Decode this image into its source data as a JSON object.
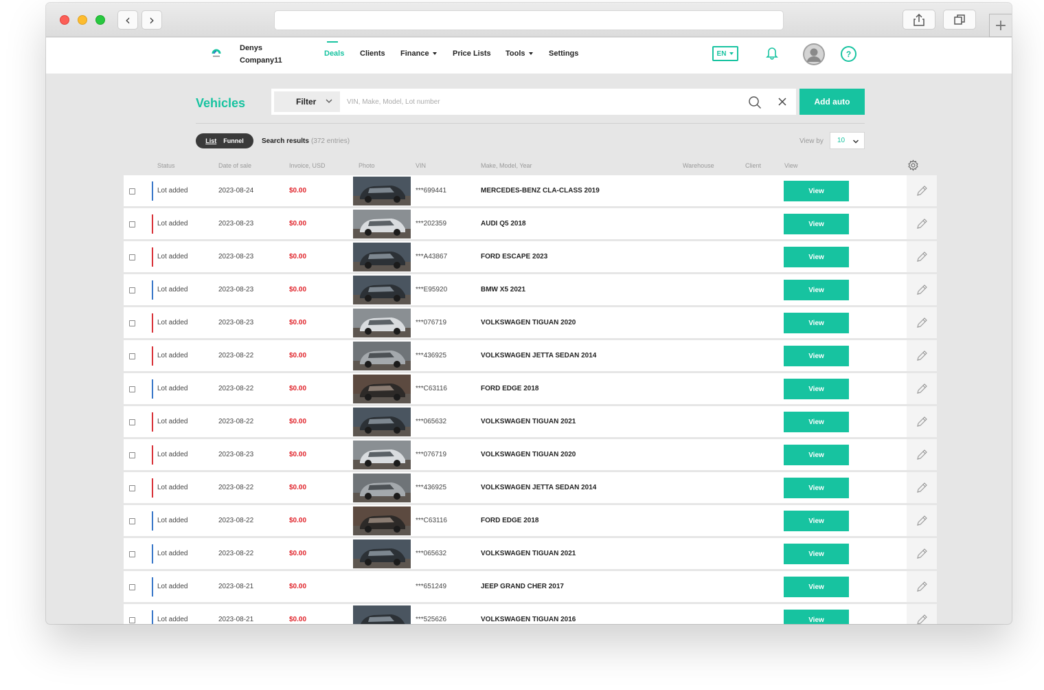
{
  "browser": {
    "back_icon": "‹",
    "forward_icon": "›",
    "new_tab_icon": "+"
  },
  "header": {
    "company_line1": "Denys",
    "company_line2": "Company11",
    "nav": [
      {
        "label": "Deals",
        "active": true
      },
      {
        "label": "Clients"
      },
      {
        "label": "Finance",
        "dropdown": true
      },
      {
        "label": "Price Lists"
      },
      {
        "label": "Tools",
        "dropdown": true
      },
      {
        "label": "Settings"
      }
    ],
    "language": "EN",
    "help": "?"
  },
  "toolbar": {
    "title": "Vehicles",
    "filter_label": "Filter",
    "search_placeholder": "VIN, Make, Model, Lot number",
    "add_label": "Add auto",
    "toggle_list": "List",
    "toggle_funnel": "Funnel",
    "results_label": "Search results",
    "results_count": "(372 entries)",
    "view_by_label": "View by",
    "view_by_value": "10"
  },
  "table": {
    "columns": [
      "Status",
      "Date of sale",
      "Invoice, USD",
      "Photo",
      "VIN",
      "Make, Model, Year",
      "Warehouse",
      "Client",
      "View"
    ],
    "view_label": "View",
    "colors": {
      "blue": "#3a78c9",
      "red": "#d9333a",
      "accent": "#17c3a0",
      "invoice": "#e0242b"
    },
    "rows": [
      {
        "status": "Lot added",
        "bar": "blue",
        "date": "2023-08-24",
        "invoice": "$0.00",
        "photo": "dark",
        "vin": "***699441",
        "model": "MERCEDES-BENZ CLA-CLASS 2019"
      },
      {
        "status": "Lot added",
        "bar": "red",
        "date": "2023-08-23",
        "invoice": "$0.00",
        "photo": "white",
        "vin": "***202359",
        "model": "AUDI Q5 2018"
      },
      {
        "status": "Lot added",
        "bar": "red",
        "date": "2023-08-23",
        "invoice": "$0.00",
        "photo": "dark",
        "vin": "***A43867",
        "model": "FORD ESCAPE 2023"
      },
      {
        "status": "Lot added",
        "bar": "blue",
        "date": "2023-08-23",
        "invoice": "$0.00",
        "photo": "dark",
        "vin": "***E95920",
        "model": "BMW X5 2021"
      },
      {
        "status": "Lot added",
        "bar": "red",
        "date": "2023-08-23",
        "invoice": "$0.00",
        "photo": "white",
        "vin": "***076719",
        "model": "VOLKSWAGEN TIGUAN 2020"
      },
      {
        "status": "Lot added",
        "bar": "red",
        "date": "2023-08-22",
        "invoice": "$0.00",
        "photo": "gray",
        "vin": "***436925",
        "model": "VOLKSWAGEN JETTA SEDAN 2014"
      },
      {
        "status": "Lot added",
        "bar": "blue",
        "date": "2023-08-22",
        "invoice": "$0.00",
        "photo": "brown",
        "vin": "***C63116",
        "model": "FORD EDGE 2018"
      },
      {
        "status": "Lot added",
        "bar": "red",
        "date": "2023-08-22",
        "invoice": "$0.00",
        "photo": "dark",
        "vin": "***065632",
        "model": "VOLKSWAGEN TIGUAN 2021"
      },
      {
        "status": "Lot added",
        "bar": "red",
        "date": "2023-08-23",
        "invoice": "$0.00",
        "photo": "white",
        "vin": "***076719",
        "model": "VOLKSWAGEN TIGUAN 2020"
      },
      {
        "status": "Lot added",
        "bar": "red",
        "date": "2023-08-22",
        "invoice": "$0.00",
        "photo": "gray",
        "vin": "***436925",
        "model": "VOLKSWAGEN JETTA SEDAN 2014"
      },
      {
        "status": "Lot added",
        "bar": "blue",
        "date": "2023-08-22",
        "invoice": "$0.00",
        "photo": "brown",
        "vin": "***C63116",
        "model": "FORD EDGE 2018"
      },
      {
        "status": "Lot added",
        "bar": "blue",
        "date": "2023-08-22",
        "invoice": "$0.00",
        "photo": "dark",
        "vin": "***065632",
        "model": "VOLKSWAGEN TIGUAN 2021"
      },
      {
        "status": "Lot added",
        "bar": "blue",
        "date": "2023-08-21",
        "invoice": "$0.00",
        "photo": "none",
        "vin": "***651249",
        "model": "JEEP GRAND CHER 2017"
      },
      {
        "status": "Lot added",
        "bar": "blue",
        "date": "2023-08-21",
        "invoice": "$0.00",
        "photo": "dark",
        "vin": "***525626",
        "model": "VOLKSWAGEN TIGUAN 2016"
      }
    ]
  }
}
